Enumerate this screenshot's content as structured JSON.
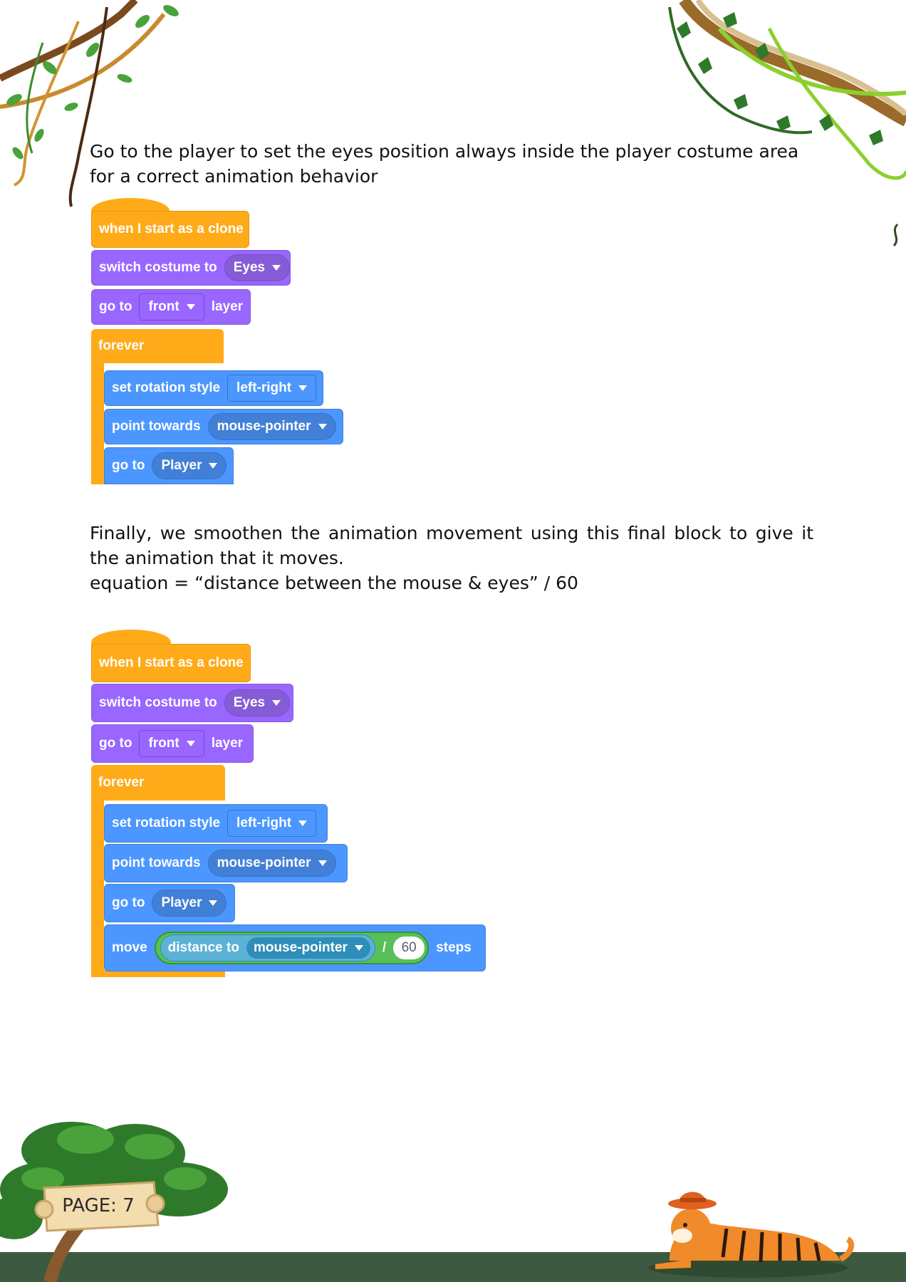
{
  "colors": {
    "events": "#ffab19",
    "looks": "#9966ff",
    "motion": "#4c97ff",
    "operators": "#59c059",
    "sensing": "#5cb1d6",
    "ground": "#3d5a40",
    "foliage": "#3e8a2e"
  },
  "instructions": {
    "first": "Go to the player to set the eyes position always inside the player costume area for a correct animation behavior",
    "second_line1": "Finally, we smoothen the animation movement using this final block to give it the animation that it moves.",
    "second_line2": "equation = “distance between the mouse & eyes” / 60"
  },
  "script1": {
    "hat": "when I start as a clone",
    "switch_costume": "switch costume to",
    "costume_value": "Eyes",
    "go_to": "go to",
    "layer_value": "front",
    "layer": "layer",
    "forever": "forever",
    "set_rotation": "set rotation style",
    "rotation_value": "left-right",
    "point_towards": "point towards",
    "towards_value": "mouse-pointer",
    "go_to_target": "go to",
    "target_value": "Player"
  },
  "script2": {
    "hat": "when I start as a clone",
    "switch_costume": "switch costume to",
    "costume_value": "Eyes",
    "go_to": "go to",
    "layer_value": "front",
    "layer": "layer",
    "forever": "forever",
    "set_rotation": "set rotation style",
    "rotation_value": "left-right",
    "point_towards": "point towards",
    "towards_value": "mouse-pointer",
    "go_to_target": "go to",
    "target_value": "Player",
    "move": "move",
    "distance_to": "distance to",
    "distance_value": "mouse-pointer",
    "divide": "/",
    "divisor": "60",
    "steps": "steps"
  },
  "footer": {
    "page_label": "PAGE: 7"
  }
}
